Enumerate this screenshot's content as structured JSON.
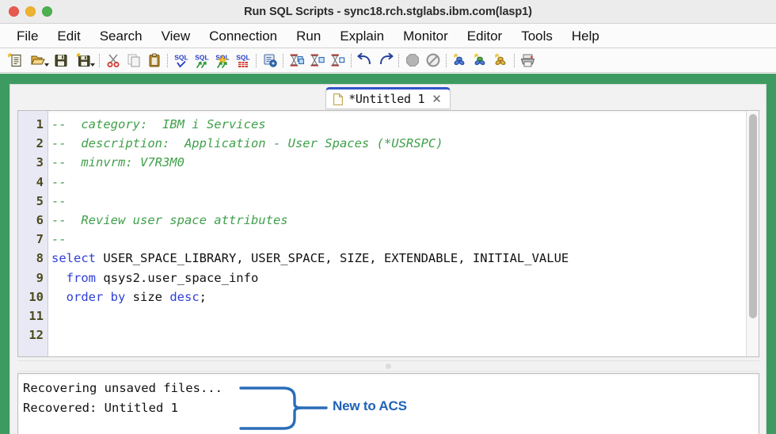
{
  "window": {
    "title": "Run SQL Scripts - sync18.rch.stglabs.ibm.com(lasp1)",
    "traffic_lights": [
      "close",
      "minimize",
      "zoom"
    ],
    "accent_green": "#3d9b62",
    "accent_blue": "#1f62b8",
    "tab_active_blue": "#2f55c8"
  },
  "menubar": {
    "items": [
      {
        "label": "File"
      },
      {
        "label": "Edit"
      },
      {
        "label": "Search"
      },
      {
        "label": "View"
      },
      {
        "label": "Connection"
      },
      {
        "label": "Run"
      },
      {
        "label": "Explain"
      },
      {
        "label": "Monitor"
      },
      {
        "label": "Editor"
      },
      {
        "label": "Tools"
      },
      {
        "label": "Help"
      }
    ]
  },
  "toolbar": {
    "groups": [
      {
        "buttons": [
          {
            "icon": "new-script-icon",
            "has_caret": false
          },
          {
            "icon": "open-folder-icon",
            "has_caret": true
          },
          {
            "icon": "save-icon",
            "has_caret": false
          },
          {
            "icon": "save-as-icon",
            "has_caret": true
          }
        ]
      },
      {
        "buttons": [
          {
            "icon": "cut-scissors-icon",
            "has_caret": false
          },
          {
            "icon": "copy-icon",
            "has_caret": false
          },
          {
            "icon": "paste-clipboard-icon",
            "has_caret": false
          }
        ]
      },
      {
        "buttons": [
          {
            "icon": "sql-check-icon",
            "has_caret": false
          },
          {
            "icon": "sql-run-all-icon",
            "has_caret": false
          },
          {
            "icon": "sql-run-selected-icon",
            "has_caret": false
          },
          {
            "icon": "sql-run-to-table-icon",
            "has_caret": false
          }
        ]
      },
      {
        "buttons": [
          {
            "icon": "sql-settings-icon",
            "has_caret": false
          }
        ]
      },
      {
        "buttons": [
          {
            "icon": "explain-hourglass-icon",
            "has_caret": false
          },
          {
            "icon": "visual-explain-icon",
            "has_caret": false
          },
          {
            "icon": "explain-only-icon",
            "has_caret": false
          }
        ]
      },
      {
        "buttons": [
          {
            "icon": "undo-arrow-icon",
            "has_caret": false
          },
          {
            "icon": "redo-arrow-icon",
            "has_caret": false
          }
        ]
      },
      {
        "buttons": [
          {
            "icon": "stop-octagon-icon",
            "has_caret": false
          },
          {
            "icon": "cancel-circle-icon",
            "has_caret": false
          }
        ]
      },
      {
        "buttons": [
          {
            "icon": "monitor-blue-icon",
            "has_caret": false
          },
          {
            "icon": "monitor-green-icon",
            "has_caret": false
          },
          {
            "icon": "monitor-yellow-icon",
            "has_caret": false
          }
        ]
      },
      {
        "buttons": [
          {
            "icon": "printer-icon",
            "has_caret": false
          }
        ]
      }
    ]
  },
  "editor": {
    "tab": {
      "icon": "document-icon",
      "label": "*Untitled 1",
      "close_icon": "close-icon",
      "close_glyph": "✕",
      "modified": true
    },
    "gutter_numbers": [
      "1",
      "2",
      "3",
      "4",
      "5",
      "6",
      "7",
      "8",
      "9",
      "10",
      "11",
      "12"
    ],
    "lines": [
      {
        "n": "1",
        "tokens": [
          {
            "t": "comment",
            "s": "--  category:  IBM i Services"
          }
        ]
      },
      {
        "n": "2",
        "tokens": [
          {
            "t": "comment",
            "s": "--  description:  Application - User Spaces (*USRSPC)"
          }
        ]
      },
      {
        "n": "3",
        "tokens": [
          {
            "t": "comment",
            "s": "--  minvrm: V7R3M0"
          }
        ]
      },
      {
        "n": "4",
        "tokens": [
          {
            "t": "comment",
            "s": "--"
          }
        ]
      },
      {
        "n": "5",
        "tokens": [
          {
            "t": "comment",
            "s": "--"
          }
        ]
      },
      {
        "n": "6",
        "tokens": [
          {
            "t": "comment",
            "s": "--  Review user space attributes"
          }
        ]
      },
      {
        "n": "7",
        "tokens": [
          {
            "t": "comment",
            "s": "--"
          }
        ]
      },
      {
        "n": "8",
        "tokens": [
          {
            "t": "keyword",
            "s": "select"
          },
          {
            "t": "plain",
            "s": " USER_SPACE_LIBRARY, USER_SPACE, SIZE, EXTENDABLE, INITIAL_VALUE"
          }
        ]
      },
      {
        "n": "9",
        "tokens": [
          {
            "t": "plain",
            "s": "  "
          },
          {
            "t": "keyword",
            "s": "from"
          },
          {
            "t": "plain",
            "s": " qsys2.user_space_info"
          }
        ]
      },
      {
        "n": "10",
        "tokens": [
          {
            "t": "plain",
            "s": "  "
          },
          {
            "t": "keyword",
            "s": "order by"
          },
          {
            "t": "plain",
            "s": " size "
          },
          {
            "t": "keyword",
            "s": "desc"
          },
          {
            "t": "plain",
            "s": ";"
          }
        ]
      },
      {
        "n": "11",
        "tokens": [
          {
            "t": "plain",
            "s": ""
          }
        ]
      },
      {
        "n": "12",
        "tokens": [
          {
            "t": "plain",
            "s": ""
          }
        ]
      }
    ],
    "scrollbar": {
      "orientation": "vertical",
      "visible": true
    }
  },
  "splitter": {
    "handle_icon": "splitter-grip-icon"
  },
  "output": {
    "lines": [
      "Recovering unsaved files...",
      "Recovered: Untitled 1"
    ]
  },
  "annotation": {
    "label": "New to ACS",
    "shape": "curly-brace",
    "color": "#1f62b8"
  }
}
